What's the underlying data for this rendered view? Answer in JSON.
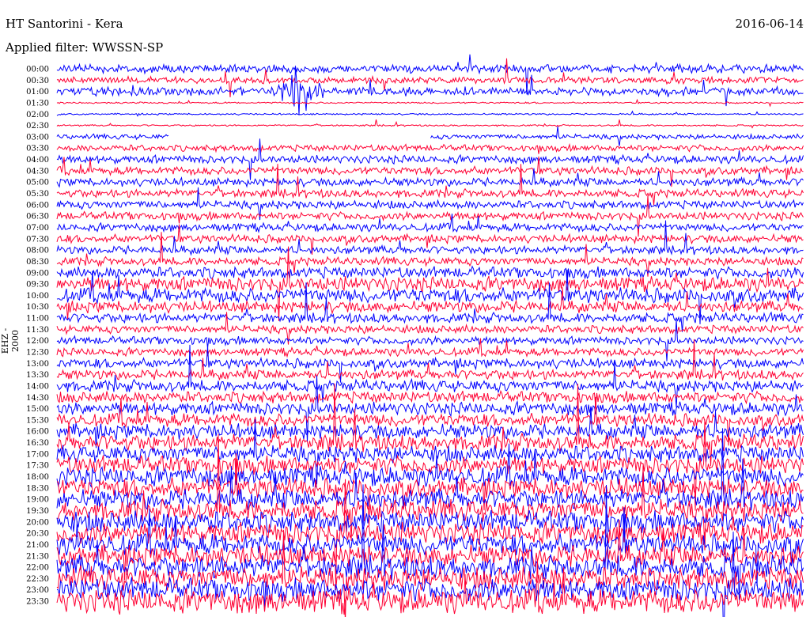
{
  "header": {
    "station": "HT Santorini - Kera",
    "date": "2016-06-14",
    "filter": "Applied filter: WWSSN-SP"
  },
  "chart_data": {
    "type": "line",
    "title": "HT Santorini - Kera",
    "subtitle": "Applied filter: WWSSN-SP",
    "ylabel": "EHZ - 2000",
    "xlabel": "",
    "minutes_per_line": 30,
    "colors": [
      "#0000ff",
      "#ff0033"
    ],
    "rows": [
      {
        "t": "00:00",
        "amp": 5
      },
      {
        "t": "00:30",
        "amp": 4
      },
      {
        "t": "01:00",
        "amp": 5
      },
      {
        "t": "01:30",
        "amp": 1
      },
      {
        "t": "02:00",
        "amp": 1
      },
      {
        "t": "02:30",
        "amp": 1
      },
      {
        "t": "03:00",
        "amp": 3
      },
      {
        "t": "03:30",
        "amp": 4
      },
      {
        "t": "04:00",
        "amp": 5
      },
      {
        "t": "04:30",
        "amp": 5
      },
      {
        "t": "05:00",
        "amp": 5
      },
      {
        "t": "05:30",
        "amp": 5
      },
      {
        "t": "06:00",
        "amp": 5
      },
      {
        "t": "06:30",
        "amp": 5
      },
      {
        "t": "07:00",
        "amp": 5
      },
      {
        "t": "07:30",
        "amp": 5
      },
      {
        "t": "08:00",
        "amp": 5
      },
      {
        "t": "08:30",
        "amp": 5
      },
      {
        "t": "09:00",
        "amp": 7
      },
      {
        "t": "09:30",
        "amp": 9
      },
      {
        "t": "10:00",
        "amp": 9
      },
      {
        "t": "10:30",
        "amp": 7
      },
      {
        "t": "11:00",
        "amp": 6
      },
      {
        "t": "11:30",
        "amp": 5
      },
      {
        "t": "12:00",
        "amp": 5
      },
      {
        "t": "12:30",
        "amp": 5
      },
      {
        "t": "13:00",
        "amp": 6
      },
      {
        "t": "13:30",
        "amp": 6
      },
      {
        "t": "14:00",
        "amp": 7
      },
      {
        "t": "14:30",
        "amp": 7
      },
      {
        "t": "15:00",
        "amp": 8
      },
      {
        "t": "15:30",
        "amp": 8
      },
      {
        "t": "16:00",
        "amp": 9
      },
      {
        "t": "16:30",
        "amp": 10
      },
      {
        "t": "17:00",
        "amp": 10
      },
      {
        "t": "17:30",
        "amp": 11
      },
      {
        "t": "18:00",
        "amp": 12
      },
      {
        "t": "18:30",
        "amp": 12
      },
      {
        "t": "19:00",
        "amp": 12
      },
      {
        "t": "19:30",
        "amp": 13
      },
      {
        "t": "20:00",
        "amp": 13
      },
      {
        "t": "20:30",
        "amp": 13
      },
      {
        "t": "21:00",
        "amp": 13
      },
      {
        "t": "21:30",
        "amp": 13
      },
      {
        "t": "22:00",
        "amp": 14
      },
      {
        "t": "22:30",
        "amp": 14
      },
      {
        "t": "23:00",
        "amp": 14
      },
      {
        "t": "23:30",
        "amp": 15
      }
    ],
    "events": [
      {
        "row": "01:00",
        "minute": 9.8,
        "amp": 55
      }
    ],
    "gaps": [
      {
        "row": "03:00",
        "from_minute": 4.5,
        "to_minute": 15
      }
    ]
  }
}
